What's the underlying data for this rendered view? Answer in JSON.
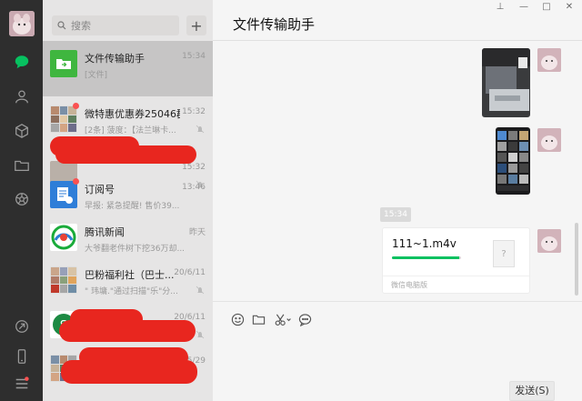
{
  "search": {
    "placeholder": "搜索",
    "add_label": "+"
  },
  "conversations": [
    {
      "name": "文件传输助手",
      "time": "15:34",
      "preview": "[文件]"
    },
    {
      "name": "微特惠优惠券25046群",
      "time": "15:32",
      "preview": "[2条] 菠度：【法兰琳卡..."
    },
    {
      "name": "",
      "time": "15:32",
      "preview": ""
    },
    {
      "name": "订阅号",
      "time": "13:46",
      "preview": "早报: 紧急提醒! 售价39..."
    },
    {
      "name": "腾讯新闻",
      "time": "昨天",
      "preview": "大爷翻老件树下挖36万却..."
    },
    {
      "name": "巴粉福利社（巴士...",
      "time": "20/6/11",
      "preview": "\" 玮墉.\"通过扫描\"乐\"分..."
    },
    {
      "name": "",
      "time": "20/6/11",
      "preview": ""
    },
    {
      "name": "",
      "time": "20/5/29",
      "preview": ""
    }
  ],
  "chat": {
    "title": "文件传输助手",
    "time_chip": "15:34",
    "file": {
      "name": "111~1.m4v",
      "source": "微信电脑版",
      "icon_text": "?",
      "progress": 0.97
    },
    "send_label": "发送(S)"
  },
  "window": {
    "pin": "⊥",
    "min": "—",
    "max": "□",
    "close": "✕"
  },
  "colors": {
    "rail": "#2e2e2e",
    "list": "#e6e5e5",
    "accent": "#07c160",
    "badge": "#fa5151"
  }
}
